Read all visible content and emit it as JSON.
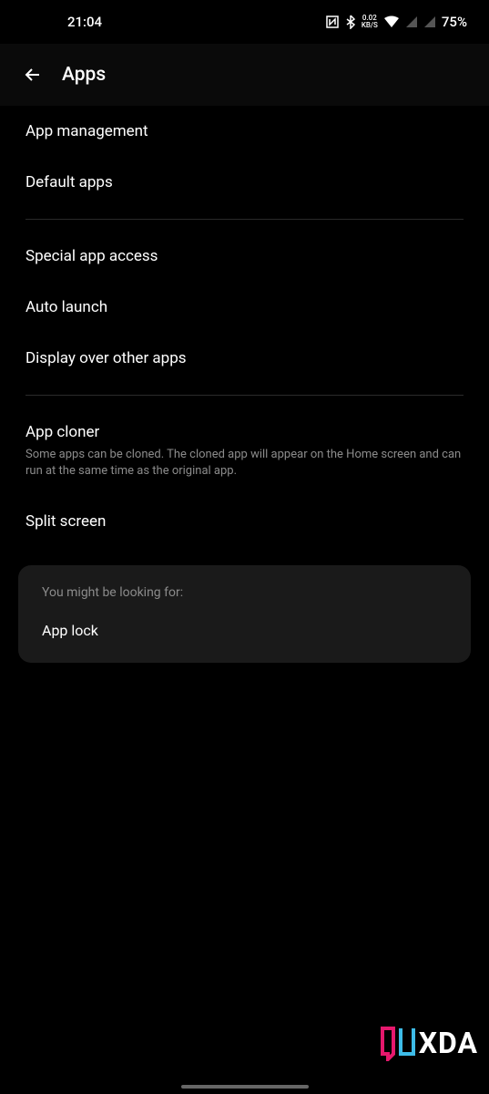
{
  "statusBar": {
    "time": "21:04",
    "networkSpeed": "0.02",
    "networkUnit": "KB/S",
    "battery": "75%"
  },
  "header": {
    "title": "Apps"
  },
  "items": {
    "appManagement": "App management",
    "defaultApps": "Default apps",
    "specialAppAccess": "Special app access",
    "autoLaunch": "Auto launch",
    "displayOverOtherApps": "Display over other apps",
    "appCloner": "App cloner",
    "appClonerDesc": "Some apps can be cloned. The cloned app will appear on the Home screen and can run at the same time as the original app.",
    "splitScreen": "Split screen"
  },
  "suggestion": {
    "header": "You might be looking for:",
    "item": "App lock"
  },
  "logo": {
    "text": "XDA"
  }
}
